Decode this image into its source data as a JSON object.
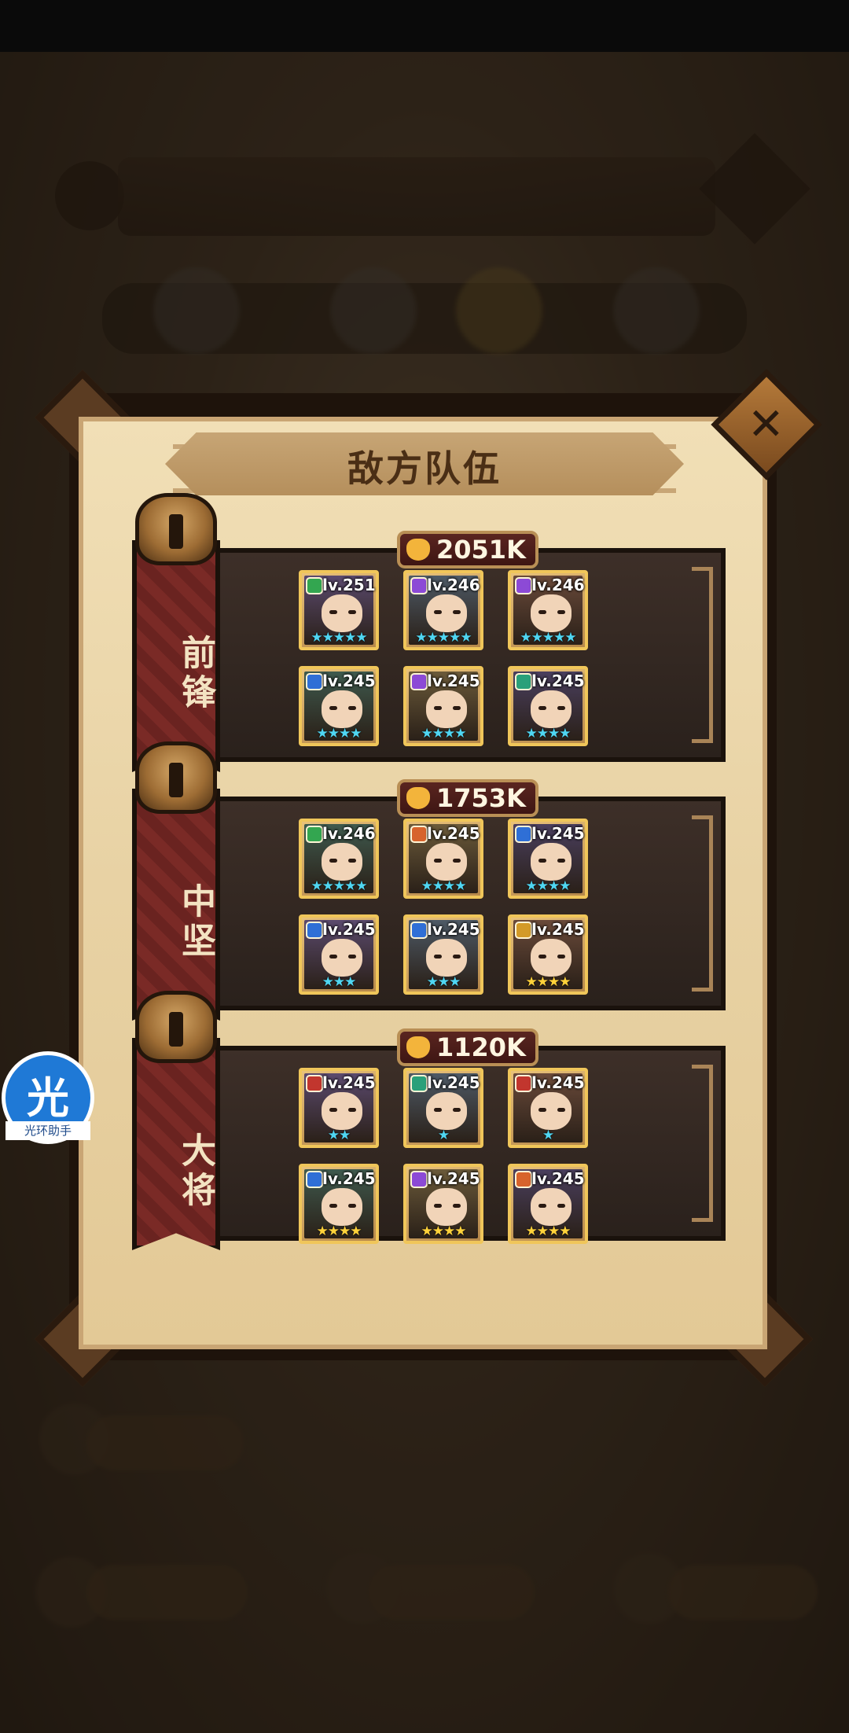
{
  "panel": {
    "title": "敌方队伍",
    "close_label": "✕"
  },
  "assistant": {
    "big_char": "光",
    "name": "光环助手"
  },
  "colors": {
    "class_green": "#33a650",
    "class_purple": "#8c4ad6",
    "class_blue": "#2f6fd6",
    "class_orange": "#d7632c",
    "class_teal": "#2aa07a",
    "class_red": "#c2362e",
    "class_gold": "#d39a28",
    "star_gold": "#ffd23a",
    "star_cyan": "#4fd6f2"
  },
  "teams": [
    {
      "label": "前锋",
      "power": "2051K",
      "heroes": [
        {
          "level": "lv.251",
          "cls": "class_green",
          "stars": "★★★★★",
          "star_color": "star_cyan"
        },
        {
          "level": "lv.246",
          "cls": "class_purple",
          "stars": "★★★★★",
          "star_color": "star_cyan"
        },
        {
          "level": "lv.246",
          "cls": "class_purple",
          "stars": "★★★★★",
          "star_color": "star_cyan"
        },
        {
          "level": "lv.245",
          "cls": "class_blue",
          "stars": "★★★★",
          "star_color": "star_cyan"
        },
        {
          "level": "lv.245",
          "cls": "class_purple",
          "stars": "★★★★",
          "star_color": "star_cyan"
        },
        {
          "level": "lv.245",
          "cls": "class_teal",
          "stars": "★★★★",
          "star_color": "star_cyan"
        }
      ]
    },
    {
      "label": "中坚",
      "power": "1753K",
      "heroes": [
        {
          "level": "lv.246",
          "cls": "class_green",
          "stars": "★★★★★",
          "star_color": "star_cyan"
        },
        {
          "level": "lv.245",
          "cls": "class_orange",
          "stars": "★★★★",
          "star_color": "star_cyan"
        },
        {
          "level": "lv.245",
          "cls": "class_blue",
          "stars": "★★★★",
          "star_color": "star_cyan"
        },
        {
          "level": "lv.245",
          "cls": "class_blue",
          "stars": "★★★",
          "star_color": "star_cyan"
        },
        {
          "level": "lv.245",
          "cls": "class_blue",
          "stars": "★★★",
          "star_color": "star_cyan"
        },
        {
          "level": "lv.245",
          "cls": "class_gold",
          "stars": "★★★★",
          "star_color": "star_gold"
        }
      ]
    },
    {
      "label": "大将",
      "power": "1120K",
      "heroes": [
        {
          "level": "lv.245",
          "cls": "class_red",
          "stars": "★★",
          "star_color": "star_cyan"
        },
        {
          "level": "lv.245",
          "cls": "class_teal",
          "stars": "★",
          "star_color": "star_cyan"
        },
        {
          "level": "lv.245",
          "cls": "class_red",
          "stars": "★",
          "star_color": "star_cyan"
        },
        {
          "level": "lv.245",
          "cls": "class_blue",
          "stars": "★★★★",
          "star_color": "star_gold"
        },
        {
          "level": "lv.245",
          "cls": "class_purple",
          "stars": "★★★★",
          "star_color": "star_gold"
        },
        {
          "level": "lv.245",
          "cls": "class_orange",
          "stars": "★★★★",
          "star_color": "star_gold"
        }
      ]
    }
  ]
}
